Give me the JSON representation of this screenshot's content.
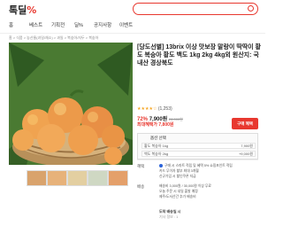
{
  "header": {
    "logo_text": "톡딜",
    "logo_pct": "%",
    "search_placeholder": ""
  },
  "nav": {
    "items": [
      "홈",
      "베스트",
      "기획전",
      "딜%",
      "공지사항",
      "이벤트"
    ]
  },
  "breadcrumb": "홈 > 식품 > 농산물(과일/채소) > 과일 > 복숭아/자두 > 복숭아",
  "product": {
    "title": "[당도선별] 13brix 이상 맛보장 말랑이 딱딱이 황도 복숭아 황도 백도 1kg 2kg 4kg외 원산지: 국내산 경상북도",
    "stars": "★★★★☆",
    "review_count": "(1,253)",
    "discount_pct": "72%",
    "price": "7,900원",
    "original_price": "28,000원",
    "best_price_label": "최대혜택가 7,800원",
    "buy_button": "구매 혜택"
  },
  "options": {
    "label": "옵션 선택",
    "rows": [
      {
        "text": "황도 복숭아 1kg",
        "price": "7,900원"
      },
      {
        "text": "백도 복숭아 2kg",
        "price": "+9,000원"
      }
    ]
  },
  "benefits": {
    "label": "혜택",
    "lines": [
      "구매 시 스마트 적립 및 혜택 5% 쇼핑포인트 적립",
      "카드 무이자 할부 최대 3개월",
      "신규가입 시 할인쿠폰 지급"
    ]
  },
  "shipping": {
    "label": "배송",
    "lines": [
      "배송비 3,000원 / 30,000원 이상 무료",
      "오늘 주문 시 내일 출발 예정",
      "제주/도서산간 추가 배송비"
    ]
  },
  "seller": {
    "name": "도착 배송일 시",
    "rating": "기사 정보 : 1"
  }
}
